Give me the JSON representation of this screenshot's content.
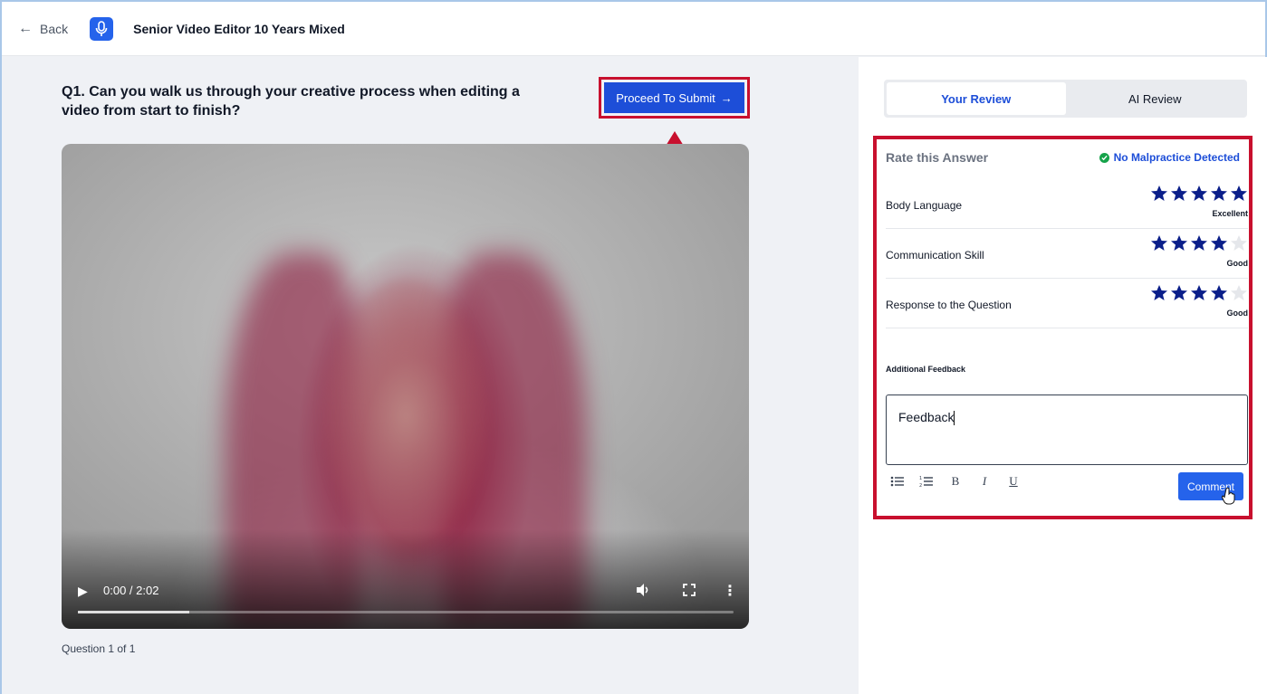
{
  "header": {
    "back_label": "Back",
    "title": "Senior Video Editor 10 Years Mixed",
    "icon": "microphone-icon"
  },
  "question": {
    "text": "Q1. Can you walk us through your creative process when editing a video from start to finish?",
    "submit_label": "Proceed To Submit",
    "count_text": "Question 1 of 1"
  },
  "video": {
    "time_text": "0:00 / 2:02",
    "buffered_fraction": 0.17
  },
  "tabs": [
    {
      "label": "Your Review",
      "active": true
    },
    {
      "label": "AI Review",
      "active": false
    }
  ],
  "review": {
    "heading": "Rate this Answer",
    "malpractice_status": "No Malpractice Detected",
    "ratings": [
      {
        "label": "Body Language",
        "stars": 5,
        "max": 5,
        "word": "Excellent"
      },
      {
        "label": "Communication Skill",
        "stars": 4,
        "max": 5,
        "word": "Good"
      },
      {
        "label": "Response to the Question",
        "stars": 4,
        "max": 5,
        "word": "Good"
      }
    ],
    "feedback_label": "Additional Feedback",
    "feedback_value": "Feedback",
    "toolbar": {
      "bullet_list": "☰",
      "numbered_list": "☰",
      "bold": "B",
      "italic": "I",
      "underline": "U"
    },
    "comment_label": "Comment"
  },
  "colors": {
    "accent": "#1d4ed8",
    "highlight_border": "#c8102e",
    "star_filled": "#0b1f8a",
    "star_empty": "#e5e7eb",
    "success": "#16a34a"
  }
}
